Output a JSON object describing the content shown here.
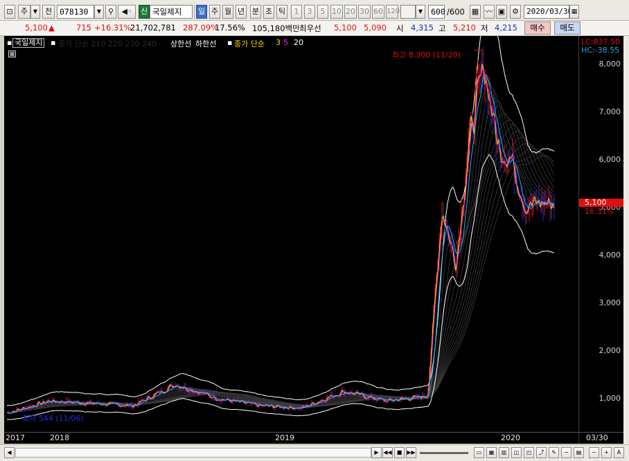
{
  "toolbar": {
    "period_label": "주",
    "view_label": "전",
    "code": "078130",
    "stock_name": "국일제지",
    "badge_new": "신",
    "tabs": [
      "일",
      "주",
      "월",
      "년",
      "분",
      "초",
      "틱"
    ],
    "active_tab": "일",
    "numbers": [
      "1",
      "3",
      "5",
      "10",
      "20",
      "30",
      "60",
      "120"
    ],
    "count": "600",
    "count_total": "/600",
    "date": "2020/03/30"
  },
  "quote": {
    "price": "5,100",
    "change": "715",
    "rate": "+16.31%",
    "volume": "21,702,781",
    "vol_rate": "287.09%",
    "turnover": "17.56%",
    "amount": "105,180백만",
    "best_label": "최우선",
    "best_ask": "5,100",
    "best_bid": "5,090",
    "open_label": "시",
    "open": "4,315",
    "high_label": "고",
    "high": "5,210",
    "low_label": "저",
    "low": "4,215",
    "buy": "매수",
    "sell": "매도"
  },
  "legend": {
    "name": "국일제지",
    "ma_long": "종가 단순 210  220  230  240",
    "upper": "상한선",
    "lower": "하한선",
    "ma_short": "종가 단순",
    "ma_short_periods": [
      "3",
      "5",
      "20"
    ]
  },
  "annotations": {
    "high_note": "최고 8,300 (11/20)",
    "low_note": "최저 544 (11/06)",
    "lc": "LC:837.50",
    "hc": "HC:-38.55",
    "last_price": "5,100",
    "last_rate": "16.31%"
  },
  "colors": {
    "up": "#e01010",
    "down": "#1632c8",
    "band": "#ffffff",
    "ma3": "#ffd400",
    "ma5": "#ff2ad0",
    "ma20": "#00c0ff"
  },
  "chart_data": {
    "type": "line",
    "title": "",
    "y_ticks": [
      1000,
      2000,
      3000,
      4000,
      5000,
      6000,
      7000,
      8000
    ],
    "ylim": [
      300,
      8600
    ],
    "x_ticks": [
      "2017",
      "2018",
      "2019",
      "2020",
      "03/30"
    ],
    "series": [
      {
        "name": "종가",
        "x": [
          "2017-01",
          "2017-04",
          "2017-07",
          "2017-10",
          "2018-01",
          "2018-04",
          "2018-07",
          "2018-10",
          "2019-01",
          "2019-04",
          "2019-07",
          "2019-08",
          "2019-09",
          "2019-10",
          "2019-11",
          "2019-12",
          "2020-01",
          "2020-02",
          "2020-03"
        ],
        "values": [
          700,
          950,
          900,
          850,
          1300,
          1000,
          850,
          800,
          1150,
          950,
          1050,
          5000,
          3800,
          6500,
          8000,
          6300,
          6000,
          5000,
          5100
        ]
      }
    ]
  }
}
